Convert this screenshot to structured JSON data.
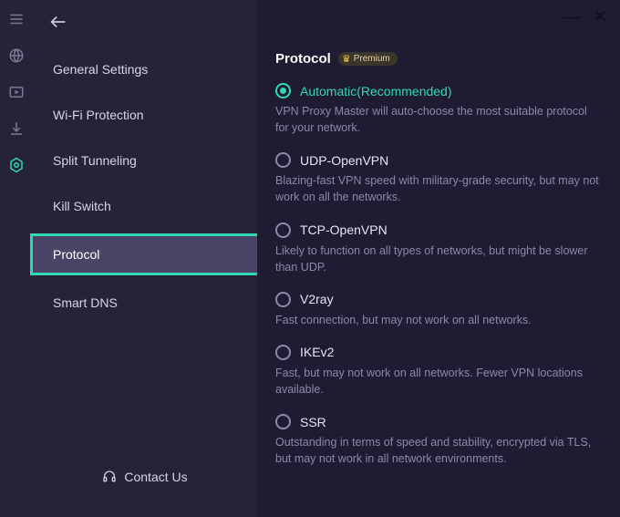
{
  "sidebar": {
    "items": [
      {
        "label": "General Settings"
      },
      {
        "label": "Wi-Fi Protection"
      },
      {
        "label": "Split Tunneling"
      },
      {
        "label": "Kill Switch"
      },
      {
        "label": "Protocol"
      },
      {
        "label": "Smart DNS"
      }
    ],
    "contact": "Contact Us"
  },
  "main": {
    "section_title": "Protocol",
    "premium_label": "Premium",
    "options": [
      {
        "title": "Automatic(Recommended)",
        "desc": "VPN Proxy Master will auto-choose the most suitable protocol for your network."
      },
      {
        "title": "UDP-OpenVPN",
        "desc": "Blazing-fast VPN speed with military-grade security, but may not work on all the networks."
      },
      {
        "title": "TCP-OpenVPN",
        "desc": "Likely to function on all types of networks, but might be slower than UDP."
      },
      {
        "title": "V2ray",
        "desc": "Fast connection, but may not work on all networks."
      },
      {
        "title": "IKEv2",
        "desc": "Fast, but may not work on all networks. Fewer VPN locations available."
      },
      {
        "title": "SSR",
        "desc": "Outstanding in terms of speed and stability, encrypted via TLS, but may not work in all network environments."
      }
    ]
  }
}
